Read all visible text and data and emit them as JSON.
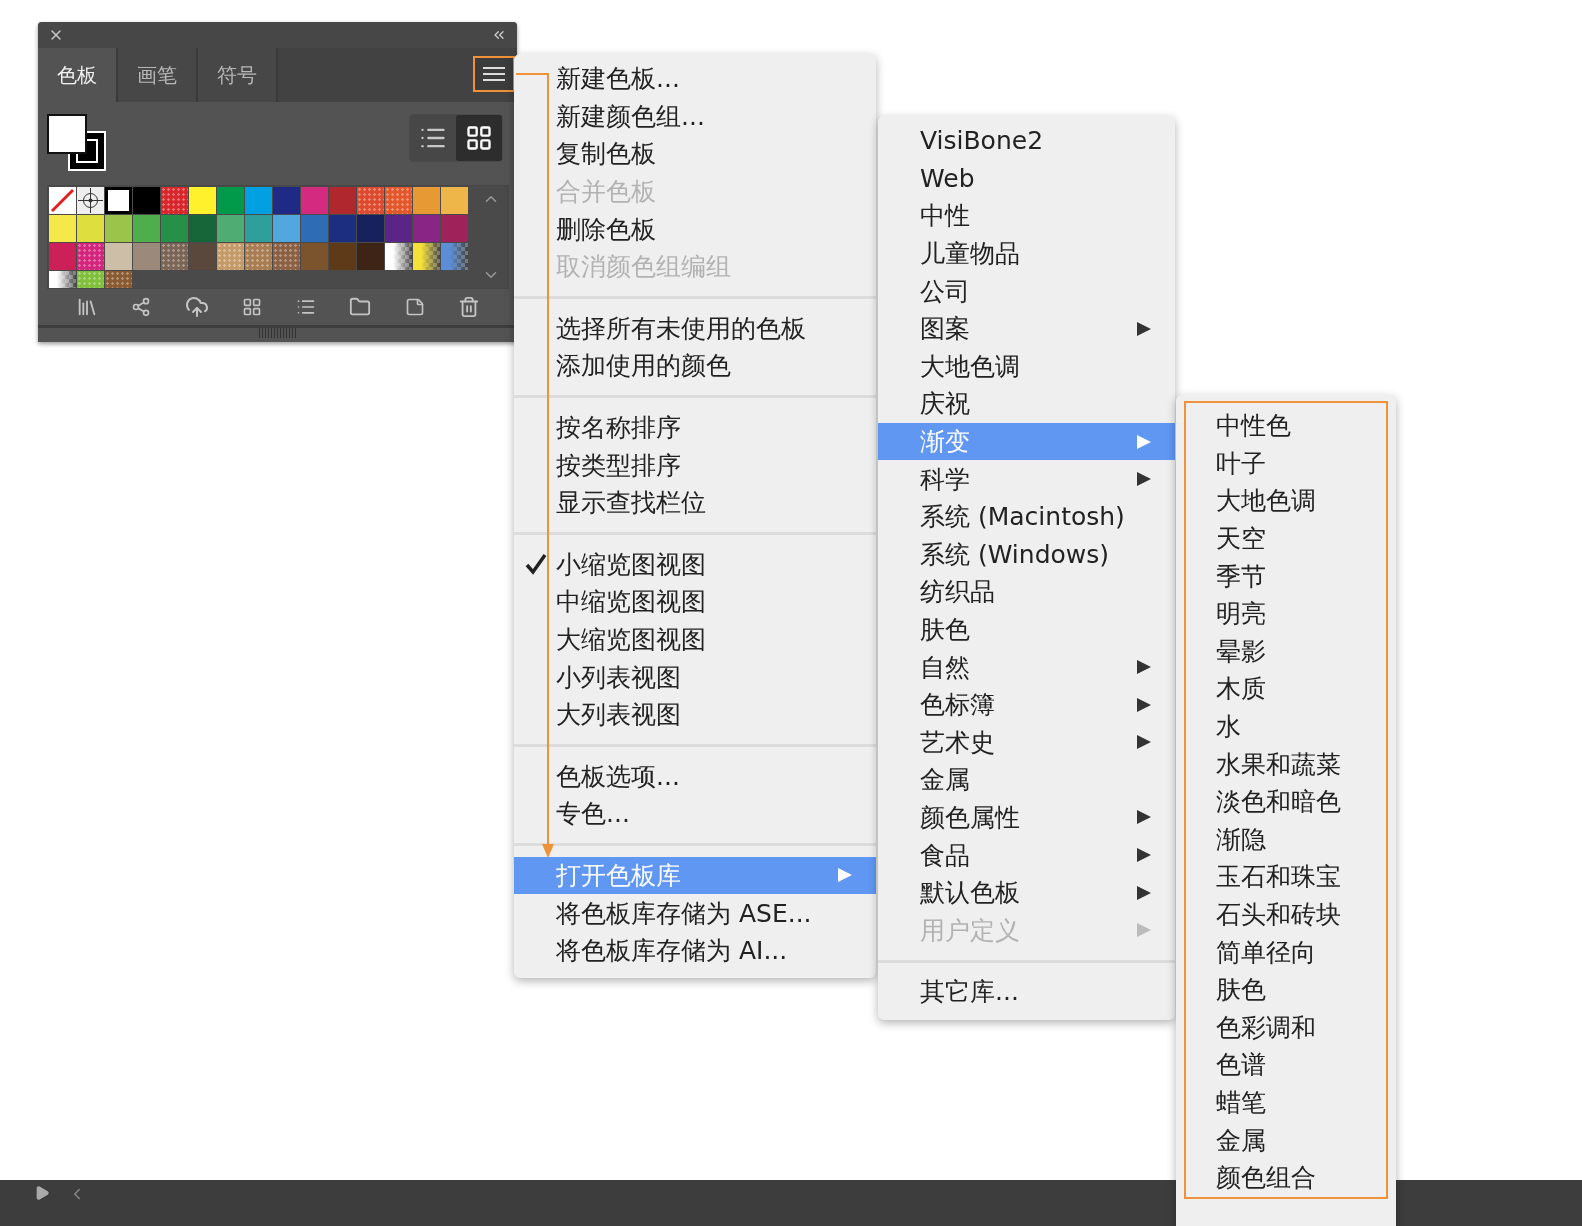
{
  "panel": {
    "tabs": [
      {
        "label": "色板",
        "selected": true
      },
      {
        "label": "画笔",
        "selected": false
      },
      {
        "label": "符号",
        "selected": false
      }
    ],
    "views": [
      {
        "kind": "list",
        "selected": false
      },
      {
        "kind": "grid",
        "selected": true
      }
    ],
    "swatches": [
      {
        "kind": "none"
      },
      {
        "kind": "registration"
      },
      {
        "kind": "framed",
        "color": "#ffffff"
      },
      {
        "kind": "color",
        "color": "#000000"
      },
      {
        "kind": "pattern",
        "color": "#d8262a"
      },
      {
        "kind": "color",
        "color": "#fff22d"
      },
      {
        "kind": "color",
        "color": "#009a4a"
      },
      {
        "kind": "color",
        "color": "#00a0e3"
      },
      {
        "kind": "color",
        "color": "#1f2a86"
      },
      {
        "kind": "color",
        "color": "#d42a7f"
      },
      {
        "kind": "color",
        "color": "#b0272d"
      },
      {
        "kind": "pattern",
        "color": "#de4a2e"
      },
      {
        "kind": "pattern",
        "color": "#e4572a"
      },
      {
        "kind": "color",
        "color": "#e79a34"
      },
      {
        "kind": "color",
        "color": "#eeb648"
      },
      {
        "kind": "color",
        "color": "#f4e84a"
      },
      {
        "kind": "color",
        "color": "#dede3e"
      },
      {
        "kind": "color",
        "color": "#9bc54a"
      },
      {
        "kind": "color",
        "color": "#4fae4c"
      },
      {
        "kind": "color",
        "color": "#279048"
      },
      {
        "kind": "color",
        "color": "#17663a"
      },
      {
        "kind": "color",
        "color": "#4fad74"
      },
      {
        "kind": "color",
        "color": "#2e9f9a"
      },
      {
        "kind": "color",
        "color": "#52a7de"
      },
      {
        "kind": "color",
        "color": "#2e6db5"
      },
      {
        "kind": "color",
        "color": "#1b2e80"
      },
      {
        "kind": "color",
        "color": "#17215e"
      },
      {
        "kind": "color",
        "color": "#5a2586"
      },
      {
        "kind": "color",
        "color": "#892585"
      },
      {
        "kind": "color",
        "color": "#a0225a"
      },
      {
        "kind": "color",
        "color": "#cb2158"
      },
      {
        "kind": "pattern",
        "color": "#d4257d"
      },
      {
        "kind": "color",
        "color": "#cdbfa7"
      },
      {
        "kind": "color",
        "color": "#9b8a7a"
      },
      {
        "kind": "pattern",
        "color": "#7b6656"
      },
      {
        "kind": "color",
        "color": "#5a483d"
      },
      {
        "kind": "pattern",
        "color": "#c49a68"
      },
      {
        "kind": "pattern",
        "color": "#a97d52"
      },
      {
        "kind": "pattern",
        "color": "#8c6143"
      },
      {
        "kind": "color",
        "color": "#7b532d"
      },
      {
        "kind": "color",
        "color": "#5e3a18"
      },
      {
        "kind": "color",
        "color": "#3e2414"
      },
      {
        "kind": "gradient",
        "color": "#ffffff"
      },
      {
        "kind": "gradient",
        "color": "#f5e03a"
      },
      {
        "kind": "gradient",
        "color": "#5a8fd8"
      },
      {
        "kind": "gradient",
        "color": "#ffffff"
      },
      {
        "kind": "pattern",
        "color": "#7fbf3a"
      },
      {
        "kind": "pattern",
        "color": "#8a5a32"
      }
    ]
  },
  "menu": {
    "groups": [
      [
        {
          "label": "新建色板...",
          "disabled": false,
          "checked": false,
          "submenu": false,
          "selected": false
        },
        {
          "label": "新建颜色组...",
          "disabled": false,
          "checked": false,
          "submenu": false,
          "selected": false
        },
        {
          "label": "复制色板",
          "disabled": false,
          "checked": false,
          "submenu": false,
          "selected": false
        },
        {
          "label": "合并色板",
          "disabled": true,
          "checked": false,
          "submenu": false,
          "selected": false
        },
        {
          "label": "删除色板",
          "disabled": false,
          "checked": false,
          "submenu": false,
          "selected": false
        },
        {
          "label": "取消颜色组编组",
          "disabled": true,
          "checked": false,
          "submenu": false,
          "selected": false
        }
      ],
      [
        {
          "label": "选择所有未使用的色板",
          "disabled": false,
          "checked": false,
          "submenu": false,
          "selected": false
        },
        {
          "label": "添加使用的颜色",
          "disabled": false,
          "checked": false,
          "submenu": false,
          "selected": false
        }
      ],
      [
        {
          "label": "按名称排序",
          "disabled": false,
          "checked": false,
          "submenu": false,
          "selected": false
        },
        {
          "label": "按类型排序",
          "disabled": false,
          "checked": false,
          "submenu": false,
          "selected": false
        },
        {
          "label": "显示查找栏位",
          "disabled": false,
          "checked": false,
          "submenu": false,
          "selected": false
        }
      ],
      [
        {
          "label": "小缩览图视图",
          "disabled": false,
          "checked": true,
          "submenu": false,
          "selected": false
        },
        {
          "label": "中缩览图视图",
          "disabled": false,
          "checked": false,
          "submenu": false,
          "selected": false
        },
        {
          "label": "大缩览图视图",
          "disabled": false,
          "checked": false,
          "submenu": false,
          "selected": false
        },
        {
          "label": "小列表视图",
          "disabled": false,
          "checked": false,
          "submenu": false,
          "selected": false
        },
        {
          "label": "大列表视图",
          "disabled": false,
          "checked": false,
          "submenu": false,
          "selected": false
        }
      ],
      [
        {
          "label": "色板选项...",
          "disabled": false,
          "checked": false,
          "submenu": false,
          "selected": false
        },
        {
          "label": "专色...",
          "disabled": false,
          "checked": false,
          "submenu": false,
          "selected": false
        }
      ],
      [
        {
          "label": "打开色板库",
          "disabled": false,
          "checked": false,
          "submenu": true,
          "selected": true
        },
        {
          "label": "将色板库存储为 ASE...",
          "disabled": false,
          "checked": false,
          "submenu": false,
          "selected": false
        },
        {
          "label": "将色板库存储为 AI...",
          "disabled": false,
          "checked": false,
          "submenu": false,
          "selected": false
        }
      ]
    ]
  },
  "library_menu": {
    "groups": [
      [
        {
          "label": "VisiBone2",
          "disabled": false,
          "submenu": false,
          "selected": false
        },
        {
          "label": "Web",
          "disabled": false,
          "submenu": false,
          "selected": false
        },
        {
          "label": "中性",
          "disabled": false,
          "submenu": false,
          "selected": false
        },
        {
          "label": "儿童物品",
          "disabled": false,
          "submenu": false,
          "selected": false
        },
        {
          "label": "公司",
          "disabled": false,
          "submenu": false,
          "selected": false
        },
        {
          "label": "图案",
          "disabled": false,
          "submenu": true,
          "selected": false
        },
        {
          "label": "大地色调",
          "disabled": false,
          "submenu": false,
          "selected": false
        },
        {
          "label": "庆祝",
          "disabled": false,
          "submenu": false,
          "selected": false
        },
        {
          "label": "渐变",
          "disabled": false,
          "submenu": true,
          "selected": true
        },
        {
          "label": "科学",
          "disabled": false,
          "submenu": true,
          "selected": false
        },
        {
          "label": "系统 (Macintosh)",
          "disabled": false,
          "submenu": false,
          "selected": false
        },
        {
          "label": "系统 (Windows)",
          "disabled": false,
          "submenu": false,
          "selected": false
        },
        {
          "label": "纺织品",
          "disabled": false,
          "submenu": false,
          "selected": false
        },
        {
          "label": "肤色",
          "disabled": false,
          "submenu": false,
          "selected": false
        },
        {
          "label": "自然",
          "disabled": false,
          "submenu": true,
          "selected": false
        },
        {
          "label": "色标簿",
          "disabled": false,
          "submenu": true,
          "selected": false
        },
        {
          "label": "艺术史",
          "disabled": false,
          "submenu": true,
          "selected": false
        },
        {
          "label": "金属",
          "disabled": false,
          "submenu": false,
          "selected": false
        },
        {
          "label": "颜色属性",
          "disabled": false,
          "submenu": true,
          "selected": false
        },
        {
          "label": "食品",
          "disabled": false,
          "submenu": true,
          "selected": false
        },
        {
          "label": "默认色板",
          "disabled": false,
          "submenu": true,
          "selected": false
        },
        {
          "label": "用户定义",
          "disabled": true,
          "submenu": true,
          "selected": false
        }
      ],
      [
        {
          "label": "其它库...",
          "disabled": false,
          "submenu": false,
          "selected": false
        }
      ]
    ]
  },
  "gradient_menu": {
    "items": [
      "中性色",
      "叶子",
      "大地色调",
      "天空",
      "季节",
      "明亮",
      "晕影",
      "木质",
      "水",
      "水果和蔬菜",
      "淡色和暗色",
      "渐隐",
      "玉石和珠宝",
      "石头和砖块",
      "简单径向",
      "肤色",
      "色彩调和",
      "色谱",
      "蜡笔",
      "金属",
      "颜色组合"
    ]
  }
}
